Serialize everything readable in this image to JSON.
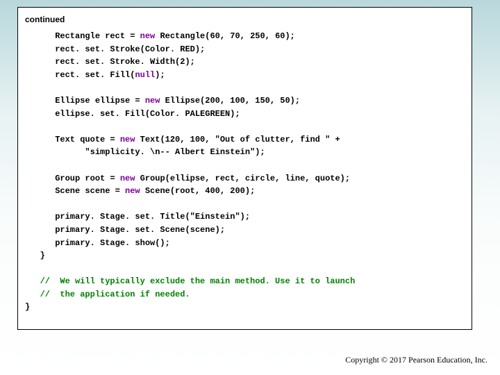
{
  "header": {
    "continued": "continued"
  },
  "code": {
    "l1a": "      Rectangle rect = ",
    "kw_new1": "new",
    "l1b": " Rectangle(60, 70, 250, 60);",
    "l2": "      rect. set. Stroke(Color. RED);",
    "l3": "      rect. set. Stroke. Width(2);",
    "l4a": "      rect. set. Fill(",
    "kw_null": "null",
    "l4b": ");",
    "l5a": "      Ellipse ellipse = ",
    "kw_new2": "new",
    "l5b": " Ellipse(200, 100, 150, 50);",
    "l6": "      ellipse. set. Fill(Color. PALEGREEN);",
    "l7a": "      Text quote = ",
    "kw_new3": "new",
    "l7b": " Text(120, 100, \"Out of clutter, find \" +",
    "l8": "            \"simplicity. \\n-- Albert Einstein\");",
    "l9a": "      Group root = ",
    "kw_new4": "new",
    "l9b": " Group(ellipse, rect, circle, line, quote);",
    "l10a": "      Scene scene = ",
    "kw_new5": "new",
    "l10b": " Scene(root, 400, 200);",
    "l11": "      primary. Stage. set. Title(\"Einstein\");",
    "l12": "      primary. Stage. set. Scene(scene);",
    "l13": "      primary. Stage. show();",
    "l14": "   }",
    "c1": "   //  We will typically exclude the main method. Use it to launch",
    "c2": "   //  the application if needed.",
    "l15": "}"
  },
  "footer": {
    "copyright": "Copyright © 2017 Pearson Education, Inc."
  }
}
